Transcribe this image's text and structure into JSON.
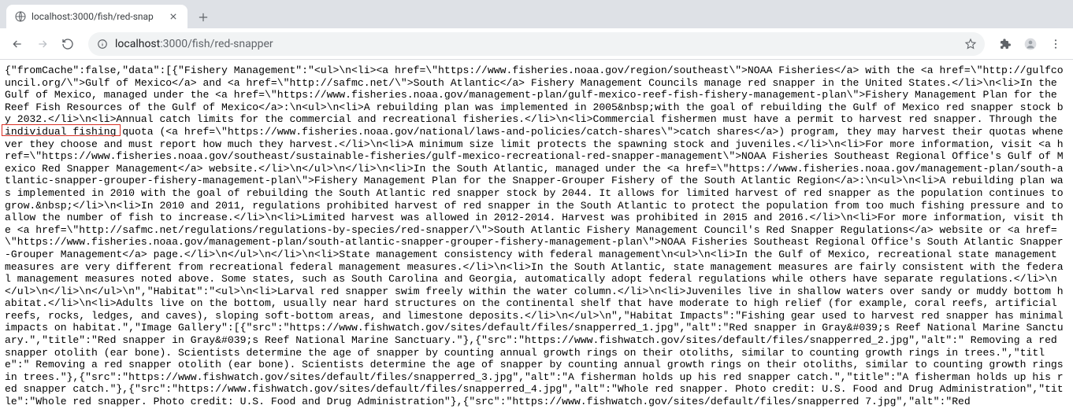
{
  "tab": {
    "title": "localhost:3000/fish/red-snap"
  },
  "url": {
    "host": "localhost",
    "port": ":3000",
    "path": "/fish/red-snapper"
  },
  "highlight": {
    "segment1": "{\"fromCache\":false,"
  },
  "json_body": "{\"fromCache\":false,\"data\":[{\"Fishery Management\":\"<ul>\\n<li><a href=\\\"https://www.fisheries.noaa.gov/region/southeast\\\">NOAA Fisheries</a> with the <a href=\\\"http://gulfcouncil.org/\\\">Gulf of Mexico</a> and <a href=\\\"http://safmc.net/\\\">South Atlantic</a> Fishery Management Councils manage red snapper in the United States.</li>\\n<li>In the Gulf of Mexico, managed under the <a href=\\\"https://www.fisheries.noaa.gov/management-plan/gulf-mexico-reef-fish-fishery-management-plan\\\">Fishery Management Plan for the Reef Fish Resources of the Gulf of Mexico</a>:\\n<ul>\\n<li>A rebuilding plan was implemented in 2005&nbsp;with the goal of rebuilding the Gulf of Mexico red snapper stock by 2032.</li>\\n<li>Annual catch limits for the commercial and recreational fisheries.</li>\\n<li>Commercial fishermen must have a permit to harvest red snapper. Through the individual fishing quota (<a href=\\\"https://www.fisheries.noaa.gov/national/laws-and-policies/catch-shares\\\">catch shares</a>) program, they may harvest their quotas whenever they choose and must report how much they harvest.</li>\\n<li>A minimum size limit protects the spawning stock and juveniles.</li>\\n<li>For more information, visit <a href=\\\"https://www.fisheries.noaa.gov/southeast/sustainable-fisheries/gulf-mexico-recreational-red-snapper-management\\\">NOAA Fisheries Southeast Regional Office's Gulf of Mexico Red Snapper Management</a> website.</li>\\n</ul>\\n</li>\\n<li>In the South Atlantic, managed under the <a href=\\\"https://www.fisheries.noaa.gov/management-plan/south-atlantic-snapper-grouper-fishery-management-plan\\\">Fishery Management Plan for the Snapper-Grouper Fishery of the South Atlantic Region</a>:\\n<ul>\\n<li>A rebuilding plan was implemented in 2010 with the goal of rebuilding the South Atlantic red snapper stock by 2044. It allows for limited harvest of red snapper as the population continues to grow.&nbsp;</li>\\n<li>In 2010 and 2011, regulations prohibited harvest of red snapper in the South Atlantic to protect the population from too much fishing pressure and to allow the number of fish to increase.</li>\\n<li>Limited harvest was allowed in 2012-2014. Harvest was prohibited in 2015 and 2016.</li>\\n<li>For more information, visit the <a href=\\\"http://safmc.net/regulations/regulations-by-species/red-snapper/\\\">South Atlantic Fishery Management Council's Red Snapper Regulations</a> website or <a href=\\\"https://www.fisheries.noaa.gov/management-plan/south-atlantic-snapper-grouper-fishery-management-plan\\\">NOAA Fisheries Southeast Regional Office's South Atlantic Snapper-Grouper Management</a> page.</li>\\n</ul>\\n</li>\\n<li>State management consistency with federal management\\n<ul>\\n<li>In the Gulf of Mexico, recreational state management measures are very different from recreational federal management measures.</li>\\n<li>In the South Atlantic, state management measures are fairly consistent with the federal management measures noted above. Some states, such as South Carolina and Georgia, automatically adopt federal regulations while others have separate regulations.</li>\\n</ul>\\n</li>\\n</ul>\\n\",\"Habitat\":\"<ul>\\n<li>Larval red snapper swim freely within the water column.</li>\\n<li>Juveniles live in shallow waters over sandy or muddy bottom habitat.</li>\\n<li>Adults live on the bottom, usually near hard structures on the continental shelf that have moderate to high relief (for example, coral reefs, artificial reefs, rocks, ledges, and caves), sloping soft-bottom areas, and limestone deposits.</li>\\n</ul>\\n\",\"Habitat Impacts\":\"Fishing gear used to harvest red snapper has minimal impacts on habitat.\",\"Image Gallery\":[{\"src\":\"https://www.fishwatch.gov/sites/default/files/snapperred_1.jpg\",\"alt\":\"Red snapper in Gray&#039;s Reef National Marine Sanctuary.\",\"title\":\"Red snapper in Gray&#039;s Reef National Marine Sanctuary.\"},{\"src\":\"https://www.fishwatch.gov/sites/default/files/snapperred_2.jpg\",\"alt\":\" Removing a red snapper otolith (ear bone). Scientists determine the age of snapper by counting annual growth rings on their otoliths, similar to counting growth rings in trees.\",\"title\":\" Removing a red snapper otolith (ear bone). Scientists determine the age of snapper by counting annual growth rings on their otoliths, similar to counting growth rings in trees.\"},{\"src\":\"https://www.fishwatch.gov/sites/default/files/snapperred_3.jpg\",\"alt\":\"A fisherman holds up his red snapper catch.\",\"title\":\"A fisherman holds up his red snapper catch.\"},{\"src\":\"https://www.fishwatch.gov/sites/default/files/snapperred_4.jpg\",\"alt\":\"Whole red snapper. Photo credit: U.S. Food and Drug Administration\",\"title\":\"Whole red snapper. Photo credit: U.S. Food and Drug Administration\"},{\"src\":\"https://www.fishwatch.gov/sites/default/files/snapperred 7.jpg\",\"alt\":\"Red"
}
